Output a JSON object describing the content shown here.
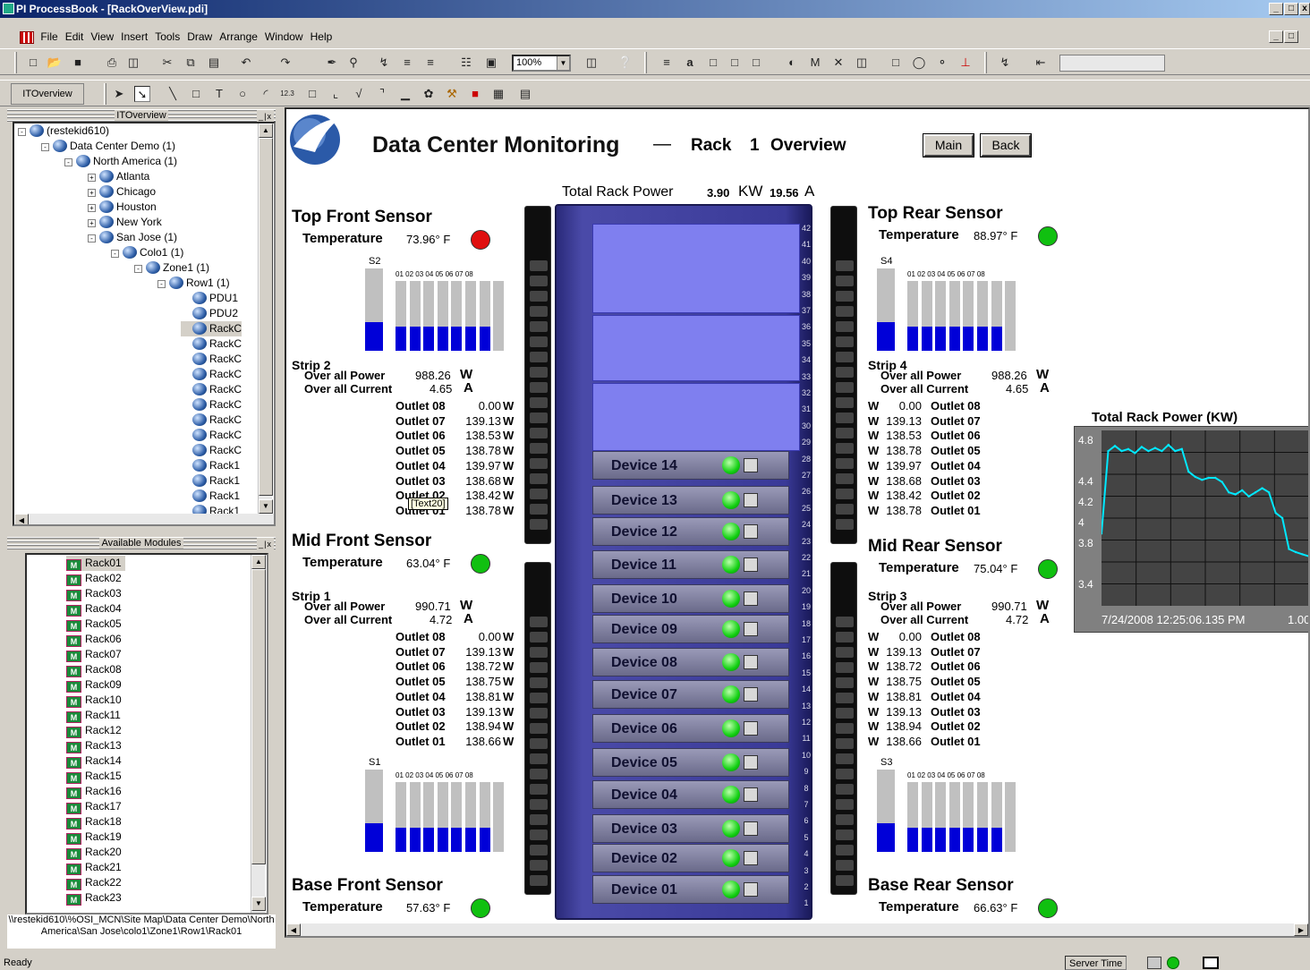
{
  "window": {
    "title": "PI ProcessBook - [RackOverView.pdi]",
    "btn_min": "_",
    "btn_max": "□",
    "btn_close": "x"
  },
  "menu": [
    "File",
    "Edit",
    "View",
    "Insert",
    "Tools",
    "Draw",
    "Arrange",
    "Window",
    "Help"
  ],
  "toolbar": {
    "zoom": "100%",
    "itoverview_label": "ITOverview"
  },
  "tree_panel": {
    "title": "ITOverview",
    "items": [
      {
        "label": "(restekid610)"
      },
      {
        "label": "Data Center Demo (1)"
      },
      {
        "label": "North America (1)"
      },
      {
        "label": "Atlanta"
      },
      {
        "label": "Chicago"
      },
      {
        "label": "Houston"
      },
      {
        "label": "New York"
      },
      {
        "label": "San Jose (1)"
      },
      {
        "label": "Colo1 (1)"
      },
      {
        "label": "Zone1 (1)"
      },
      {
        "label": "Row1 (1)"
      },
      {
        "label": "PDU1"
      },
      {
        "label": "PDU2"
      },
      {
        "label": "RackC"
      },
      {
        "label": "RackC"
      },
      {
        "label": "RackC"
      },
      {
        "label": "RackC"
      },
      {
        "label": "RackC"
      },
      {
        "label": "RackC"
      },
      {
        "label": "RackC"
      },
      {
        "label": "RackC"
      },
      {
        "label": "RackC"
      },
      {
        "label": "Rack1"
      },
      {
        "label": "Rack1"
      },
      {
        "label": "Rack1"
      },
      {
        "label": "Rack1"
      }
    ]
  },
  "modules_panel": {
    "title": "Available Modules",
    "items": [
      "Rack01",
      "Rack02",
      "Rack03",
      "Rack04",
      "Rack05",
      "Rack06",
      "Rack07",
      "Rack08",
      "Rack09",
      "Rack10",
      "Rack11",
      "Rack12",
      "Rack13",
      "Rack14",
      "Rack15",
      "Rack16",
      "Rack17",
      "Rack18",
      "Rack19",
      "Rack20",
      "Rack21",
      "Rack22",
      "Rack23"
    ],
    "path": "\\\\restekid610\\%OSI_MCN\\Site Map\\Data Center Demo\\North America\\San Jose\\colo1\\Zone1\\Row1\\Rack01"
  },
  "display": {
    "title": "Data Center Monitoring",
    "dash": "—",
    "rack_prefix": "Rack",
    "rack_num": "1",
    "rack_suffix": "Overview",
    "main_btn": "Main",
    "back_btn": "Back",
    "total_power_label": "Total Rack Power",
    "total_power_kw_val": "3.90",
    "total_power_kw_unit": "KW",
    "total_power_a_val": "19.56",
    "total_power_a_unit": "A",
    "tooltip": "[Text20]",
    "sensors": {
      "top_front": {
        "name": "Top Front Sensor",
        "label": "Temperature",
        "value": "73.96° F",
        "status_color": "#e01010"
      },
      "mid_front": {
        "name": "Mid Front Sensor",
        "label": "Temperature",
        "value": "63.04° F",
        "status_color": "#10c010"
      },
      "base_front": {
        "name": "Base Front Sensor",
        "label": "Temperature",
        "value": "57.63° F",
        "status_color": "#10c010"
      },
      "top_rear": {
        "name": "Top Rear Sensor",
        "label": "Temperature",
        "value": "88.97° F",
        "status_color": "#10c010"
      },
      "mid_rear": {
        "name": "Mid Rear Sensor",
        "label": "Temperature",
        "value": "75.04° F",
        "status_color": "#10c010"
      },
      "base_rear": {
        "name": "Base Rear Sensor",
        "label": "Temperature",
        "value": "66.63° F",
        "status_color": "#10c010"
      }
    },
    "strips": {
      "strip2": {
        "name": "Strip 2",
        "power_label": "Over all Power",
        "power": "988.26",
        "power_unit": "W",
        "current_label": "Over all Current",
        "current": "4.65",
        "current_unit": "A",
        "outlets": [
          {
            "n": "Outlet 08",
            "v": "0.00",
            "u": "W"
          },
          {
            "n": "Outlet 07",
            "v": "139.13",
            "u": "W"
          },
          {
            "n": "Outlet 06",
            "v": "138.53",
            "u": "W"
          },
          {
            "n": "Outlet 05",
            "v": "138.78",
            "u": "W"
          },
          {
            "n": "Outlet 04",
            "v": "139.97",
            "u": "W"
          },
          {
            "n": "Outlet 03",
            "v": "138.68",
            "u": "W"
          },
          {
            "n": "Outlet 02",
            "v": "138.42",
            "u": "W"
          },
          {
            "n": "Outlet 01",
            "v": "138.78",
            "u": "W"
          }
        ]
      },
      "strip4": {
        "name": "Strip 4",
        "power_label": "Over all Power",
        "power": "988.26",
        "power_unit": "W",
        "current_label": "Over all Current",
        "current": "4.65",
        "current_unit": "A",
        "outlets": [
          {
            "n": "Outlet 08",
            "v": "0.00",
            "u": "W"
          },
          {
            "n": "Outlet 07",
            "v": "139.13",
            "u": "W"
          },
          {
            "n": "Outlet 06",
            "v": "138.53",
            "u": "W"
          },
          {
            "n": "Outlet 05",
            "v": "138.78",
            "u": "W"
          },
          {
            "n": "Outlet 04",
            "v": "139.97",
            "u": "W"
          },
          {
            "n": "Outlet 03",
            "v": "138.68",
            "u": "W"
          },
          {
            "n": "Outlet 02",
            "v": "138.42",
            "u": "W"
          },
          {
            "n": "Outlet 01",
            "v": "138.78",
            "u": "W"
          }
        ]
      },
      "strip1": {
        "name": "Strip 1",
        "power_label": "Over all Power",
        "power": "990.71",
        "power_unit": "W",
        "current_label": "Over all Current",
        "current": "4.72",
        "current_unit": "A",
        "outlets": [
          {
            "n": "Outlet 08",
            "v": "0.00",
            "u": "W"
          },
          {
            "n": "Outlet 07",
            "v": "139.13",
            "u": "W"
          },
          {
            "n": "Outlet 06",
            "v": "138.72",
            "u": "W"
          },
          {
            "n": "Outlet 05",
            "v": "138.75",
            "u": "W"
          },
          {
            "n": "Outlet 04",
            "v": "138.81",
            "u": "W"
          },
          {
            "n": "Outlet 03",
            "v": "139.13",
            "u": "W"
          },
          {
            "n": "Outlet 02",
            "v": "138.94",
            "u": "W"
          },
          {
            "n": "Outlet 01",
            "v": "138.66",
            "u": "W"
          }
        ]
      },
      "strip3": {
        "name": "Strip 3",
        "power_label": "Over all Power",
        "power": "990.71",
        "power_unit": "W",
        "current_label": "Over all Current",
        "current": "4.72",
        "current_unit": "A",
        "outlets": [
          {
            "n": "Outlet 08",
            "v": "0.00",
            "u": "W"
          },
          {
            "n": "Outlet 07",
            "v": "139.13",
            "u": "W"
          },
          {
            "n": "Outlet 06",
            "v": "138.72",
            "u": "W"
          },
          {
            "n": "Outlet 05",
            "v": "138.75",
            "u": "W"
          },
          {
            "n": "Outlet 04",
            "v": "138.81",
            "u": "W"
          },
          {
            "n": "Outlet 03",
            "v": "139.13",
            "u": "W"
          },
          {
            "n": "Outlet 02",
            "v": "138.94",
            "u": "W"
          },
          {
            "n": "Outlet 01",
            "v": "138.66",
            "u": "W"
          }
        ]
      }
    },
    "bargraphs": {
      "s2": {
        "label": "S2",
        "outlet_ticks": "01 02 03 04 05 06 07 08",
        "main_level": 0.35,
        "outlet_levels": [
          0.35,
          0.35,
          0.35,
          0.35,
          0.35,
          0.35,
          0.35,
          0.0
        ]
      },
      "s4": {
        "label": "S4",
        "outlet_ticks": "01 02 03 04 05 06 07 08",
        "main_level": 0.35,
        "outlet_levels": [
          0.35,
          0.35,
          0.35,
          0.35,
          0.35,
          0.35,
          0.35,
          0.0
        ]
      },
      "s1": {
        "label": "S1",
        "outlet_ticks": "01 02 03 04 05 06 07 08",
        "main_level": 0.35,
        "outlet_levels": [
          0.35,
          0.35,
          0.35,
          0.35,
          0.35,
          0.35,
          0.35,
          0.0
        ]
      },
      "s3": {
        "label": "S3",
        "outlet_ticks": "01 02 03 04 05 06 07 08",
        "main_level": 0.35,
        "outlet_levels": [
          0.35,
          0.35,
          0.35,
          0.35,
          0.35,
          0.35,
          0.35,
          0.0
        ]
      }
    },
    "devices": [
      "Device 14",
      "Device 13",
      "Device 12",
      "Device 11",
      "Device 10",
      "Device 09",
      "Device 08",
      "Device 07",
      "Device 06",
      "Device 05",
      "Device 04",
      "Device 03",
      "Device 02",
      "Device 01"
    ],
    "rack_units": [
      "42",
      "41",
      "40",
      "39",
      "38",
      "37",
      "36",
      "35",
      "34",
      "33",
      "32",
      "31",
      "30",
      "29",
      "28",
      "27",
      "26",
      "25",
      "24",
      "23",
      "22",
      "21",
      "20",
      "19",
      "18",
      "17",
      "16",
      "15",
      "14",
      "13",
      "12",
      "11",
      "10",
      "9",
      "8",
      "7",
      "6",
      "5",
      "4",
      "3",
      "2",
      "1"
    ]
  },
  "chart_data": {
    "type": "line",
    "title": "Total Rack Power (KW)",
    "ylim": [
      3.2,
      4.9
    ],
    "yticks": [
      "4.8",
      "4.4",
      "4.2",
      "4",
      "3.8",
      "3.4"
    ],
    "x_label_text": "7/24/2008 12:25:06.135 PM",
    "x_label_extra": "1.00",
    "series": [
      {
        "values": [
          3.9,
          4.7,
          4.75,
          4.7,
          4.72,
          4.68,
          4.74,
          4.7,
          4.73,
          4.7,
          4.76,
          4.7,
          4.72,
          4.5,
          4.45,
          4.42,
          4.44,
          4.44,
          4.4,
          4.3,
          4.28,
          4.32,
          4.26,
          4.3,
          4.34,
          4.3,
          4.1,
          4.05,
          3.75,
          3.72,
          3.7,
          3.68
        ]
      }
    ],
    "grid": true
  },
  "status": {
    "ready": "Ready",
    "server_time": "Server Time"
  }
}
